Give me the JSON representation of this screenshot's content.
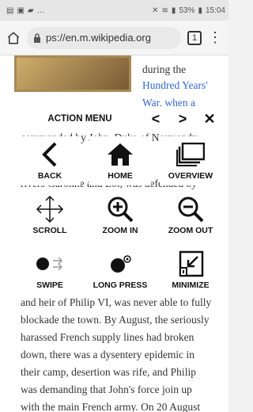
{
  "status": {
    "time": "15:04",
    "battery": "53%"
  },
  "browser": {
    "url": "ps://en.m.wikipedia.org",
    "tab_count": "1"
  },
  "article": {
    "lines": [
      {
        "text": "during the"
      },
      {
        "text": "Hundred Years'",
        "link": true
      },
      {
        "text": "War, when a"
      },
      {
        "text": "commanded by John, Duke of Normandy"
      },
      {
        "text": "rivers Garonne and Lot, was defended by"
      },
      {
        "text": "and heir of Philip VI, was never able to fully"
      },
      {
        "text": "blockade the town. By August, the seriously"
      },
      {
        "text": "harassed French supply lines had broken"
      },
      {
        "text": "down, there was a dysentery epidemic in"
      },
      {
        "text": "their camp, desertion was rife, and Philip"
      },
      {
        "text": "was demanding that John's force join up"
      },
      {
        "text": "with the main French army. On 20 August"
      }
    ]
  },
  "action_menu": {
    "title": "ACTION MENU",
    "prev": "<",
    "next": ">",
    "close": "✕",
    "tiles": [
      {
        "label": "BACK",
        "icon": "chevron-left-icon"
      },
      {
        "label": "HOME",
        "icon": "home-icon"
      },
      {
        "label": "OVERVIEW",
        "icon": "overview-icon"
      },
      {
        "label": "SCROLL",
        "icon": "scroll-arrows-icon"
      },
      {
        "label": "ZOOM IN",
        "icon": "zoom-in-icon"
      },
      {
        "label": "ZOOM OUT",
        "icon": "zoom-out-icon"
      },
      {
        "label": "SWIPE",
        "icon": "swipe-icon"
      },
      {
        "label": "LONG PRESS",
        "icon": "long-press-icon"
      },
      {
        "label": "MINIMIZE",
        "icon": "minimize-icon"
      }
    ]
  }
}
